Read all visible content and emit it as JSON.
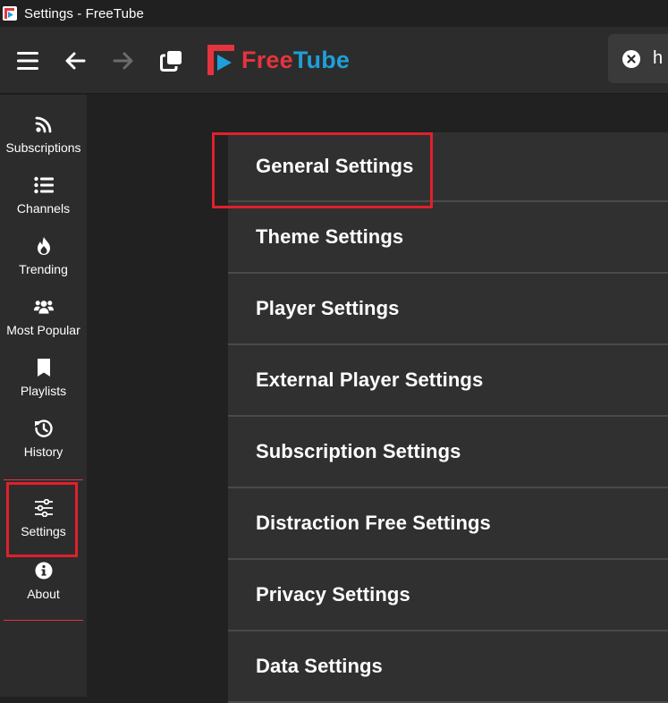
{
  "window": {
    "title": "Settings - FreeTube"
  },
  "topnav": {
    "logo_free": "Free",
    "logo_tube": "Tube",
    "search_value": "h"
  },
  "sidebar": {
    "items": [
      {
        "label": "Subscriptions",
        "icon": "rss-icon"
      },
      {
        "label": "Channels",
        "icon": "list-icon"
      },
      {
        "label": "Trending",
        "icon": "fire-icon"
      },
      {
        "label": "Most Popular",
        "icon": "users-icon"
      },
      {
        "label": "Playlists",
        "icon": "bookmark-icon"
      },
      {
        "label": "History",
        "icon": "history-icon"
      },
      {
        "label": "Settings",
        "icon": "sliders-icon"
      },
      {
        "label": "About",
        "icon": "info-icon"
      }
    ]
  },
  "settings": {
    "sections": [
      {
        "title": "General Settings"
      },
      {
        "title": "Theme Settings"
      },
      {
        "title": "Player Settings"
      },
      {
        "title": "External Player Settings"
      },
      {
        "title": "Subscription Settings"
      },
      {
        "title": "Distraction Free Settings"
      },
      {
        "title": "Privacy Settings"
      },
      {
        "title": "Data Settings"
      }
    ]
  },
  "colors": {
    "accent_red": "#e4343e",
    "accent_blue": "#1e9fd9",
    "highlight": "#e0202c"
  }
}
